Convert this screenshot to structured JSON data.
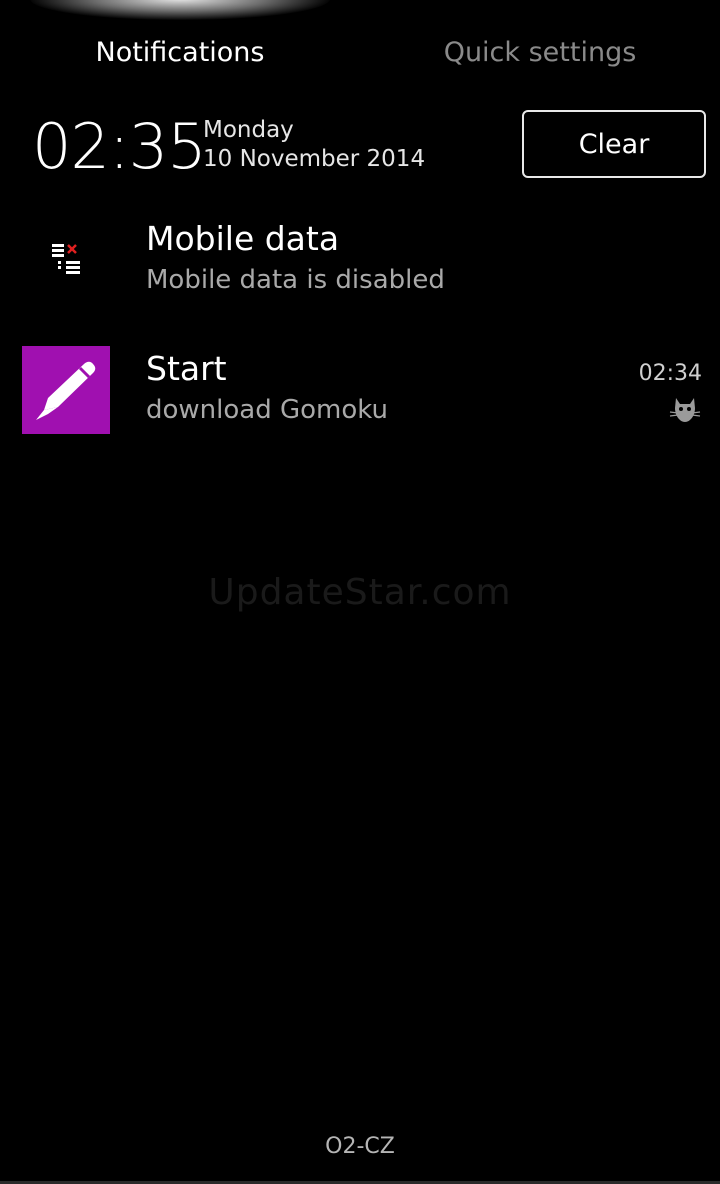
{
  "tabs": [
    {
      "label": "Notifications",
      "active": true
    },
    {
      "label": "Quick settings",
      "active": false
    }
  ],
  "clock": {
    "time": "02:35",
    "day": "Monday",
    "date": "10 November 2014"
  },
  "clear_button": {
    "label": "Clear"
  },
  "notifications": [
    {
      "icon": "mobile-data-disabled-icon",
      "title": "Mobile data",
      "subtitle": "Mobile data is disabled"
    },
    {
      "icon": "pencil-icon",
      "icon_color": "#a010b0",
      "title": "Start",
      "subtitle": "download Gomoku",
      "time": "02:34",
      "small_icon": "cat-icon"
    }
  ],
  "watermark": "UpdateStar.com",
  "carrier": "O2-CZ"
}
